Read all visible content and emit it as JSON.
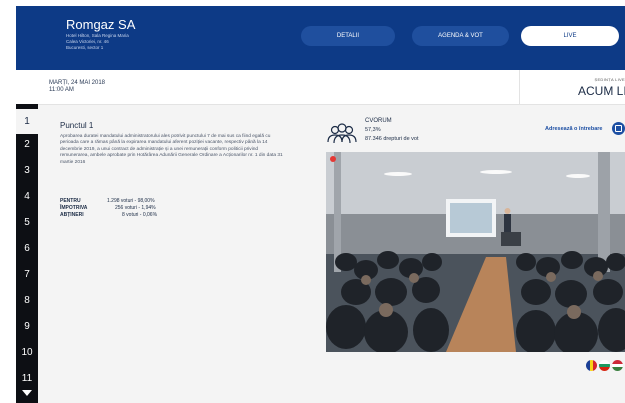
{
  "header": {
    "company": "Romgaz SA",
    "address_lines": [
      "Hotel Hilton, Sala Regina Maria",
      "Calea Victoriei, nr. 46",
      "Bucuresti, sector 1"
    ],
    "tabs": [
      {
        "label": "DETALII",
        "active": false
      },
      {
        "label": "AGENDA & VOT",
        "active": false
      },
      {
        "label": "LIVE",
        "active": true
      }
    ]
  },
  "datebar": {
    "date": "MARȚI, 24 MAI 2018",
    "time": "11:00 AM",
    "state_label": "ȘEDINȚA LIVE",
    "state_value": "ACUM LIVE"
  },
  "sidebar": {
    "points": [
      "1",
      "2",
      "3",
      "4",
      "5",
      "6",
      "7",
      "8",
      "9",
      "10",
      "11"
    ],
    "active_index": 0
  },
  "item": {
    "title": "Punctul 1",
    "description": "Aprobarea duratei mandatului administratorului ales potrivit punctului 7 de mai sus ca fiind egală cu perioada care a rămas până la expirarea mandatului aferent poziției vacante, respectiv până la 14 decembrie 2019, a unui contract de administrație și a unei remunerații conform politicii privind remunerarea, ambele aprobate prin Hotărârea Adunării Generale Ordinare a Acționarilor nr. 1 din data 31 martie 2016",
    "votes": [
      {
        "label": "PENTRU",
        "value": "1.298 voturi - 98,00%"
      },
      {
        "label": "ÎMPOTRIVA",
        "value": "256 voturi - 1,94%"
      },
      {
        "label": "ABȚINERI",
        "value": "8 voturi - 0,06%"
      }
    ]
  },
  "quorum": {
    "label": "CVORUM",
    "percent": "57,3%",
    "votes": "87.346 drepturi de vot"
  },
  "ask": {
    "label": "Adresează o întrebare"
  },
  "colors": {
    "brand": "#0d3a86",
    "sidebar": "#0d0f14",
    "live": "#e53935"
  },
  "flags": [
    "romania-flag",
    "bulgaria-flag",
    "hungary-flag"
  ]
}
